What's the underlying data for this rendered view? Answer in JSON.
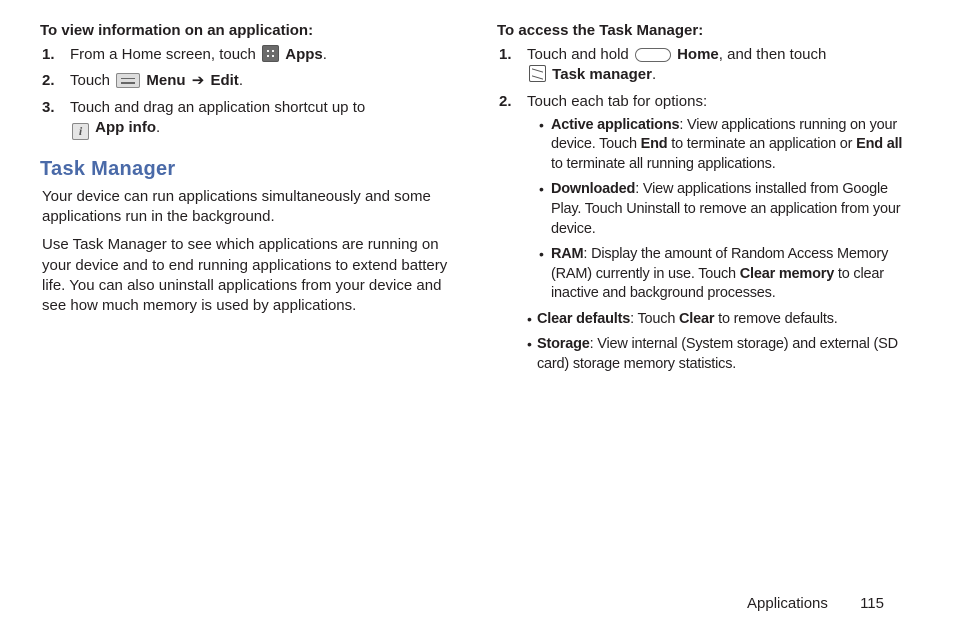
{
  "left": {
    "heading": "To view information on an application:",
    "step1_prefix": "From a Home screen, touch ",
    "step1_icon_label": "Apps",
    "step1_period": ".",
    "step2_prefix": "Touch ",
    "step2_menu": "Menu",
    "step2_arrow": "➔",
    "step2_edit": "Edit",
    "step2_period": ".",
    "step3_line1": "Touch and drag an application shortcut up to",
    "step3_appinfo": "App info",
    "step3_period": ".",
    "section_title": "Task Manager",
    "para1": "Your device can run applications simultaneously and some applications run in the background.",
    "para2": "Use Task Manager to see which applications are running on your device and to end running applications to extend battery life. You can also uninstall applications from your device and see how much memory is used by applications."
  },
  "right": {
    "heading": "To access the Task Manager:",
    "step1_prefix": "Touch and hold ",
    "step1_home": "Home",
    "step1_then": ", and then touch",
    "step1_taskmgr": "Task manager",
    "step1_period": ".",
    "step2_text": "Touch each tab for options:",
    "b1_label": "Active applications",
    "b1_rest": ": View applications running on your device. Touch ",
    "b1_end": "End",
    "b1_mid": " to terminate an application or ",
    "b1_endall": "End all",
    "b1_tail": " to terminate all running applications.",
    "b2_label": "Downloaded",
    "b2_rest": ": View applications installed from Google Play. Touch Uninstall to remove an application from your device.",
    "b3_label": "RAM",
    "b3_rest": ": Display the amount of Random Access Memory (RAM) currently in use. Touch ",
    "b3_clear": "Clear memory",
    "b3_tail": " to clear inactive and background processes.",
    "b4_label": "Clear defaults",
    "b4_rest": ": Touch ",
    "b4_clear": "Clear",
    "b4_tail": " to remove defaults.",
    "b5_label": "Storage",
    "b5_rest": ": View internal (System storage) and external (SD card) storage memory statistics."
  },
  "footer": {
    "section": "Applications",
    "page": "115"
  },
  "icons": {
    "info_glyph": "i"
  }
}
